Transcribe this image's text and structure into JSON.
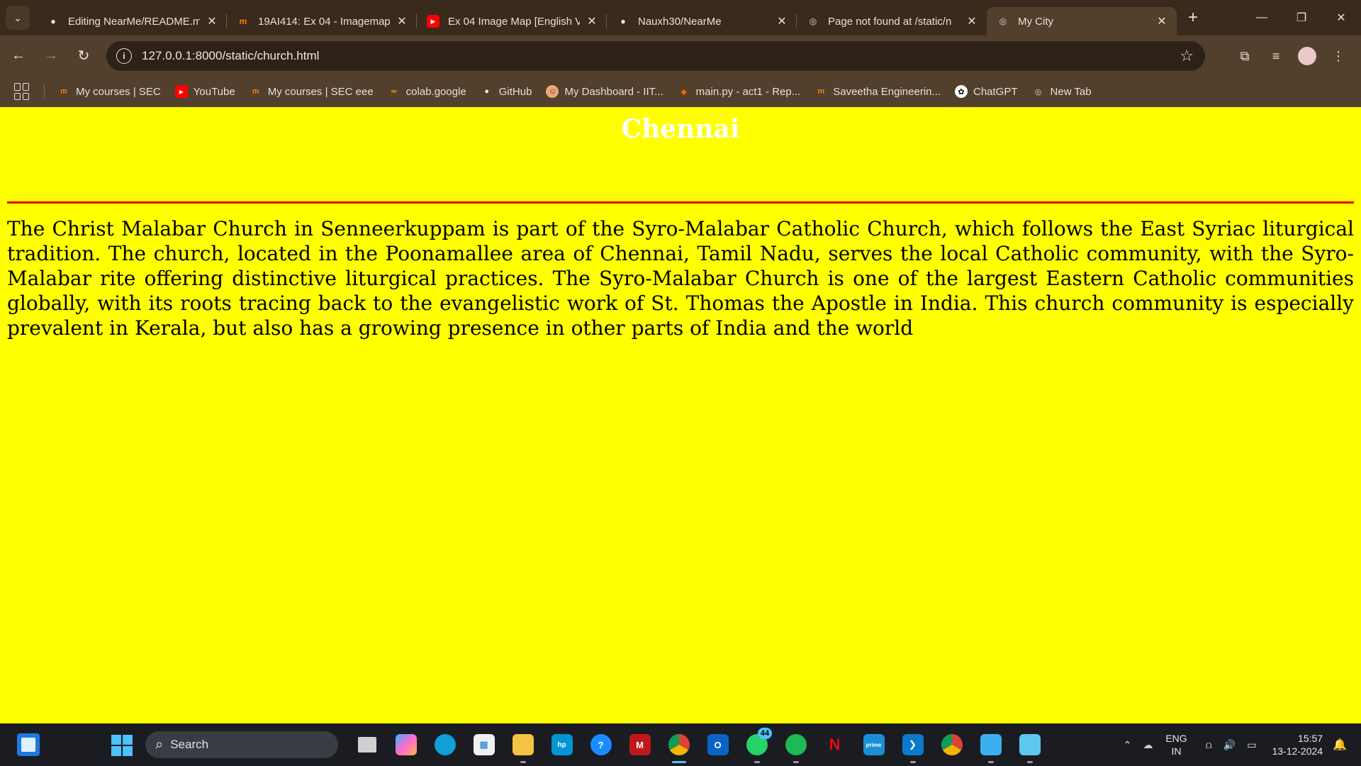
{
  "browser": {
    "tabs": [
      {
        "title": "Editing NearMe/README.md",
        "favicon": "github-icon",
        "active": false
      },
      {
        "title": "19AI414: Ex 04 - Imagemap",
        "favicon": "moodle-icon",
        "active": false
      },
      {
        "title": "Ex 04 Image Map [English V",
        "favicon": "youtube-icon",
        "active": false
      },
      {
        "title": "Nauxh30/NearMe",
        "favicon": "github-icon",
        "active": false
      },
      {
        "title": "Page not found at /static/n",
        "favicon": "globe-icon",
        "active": false
      },
      {
        "title": "My City",
        "favicon": "globe-icon",
        "active": true
      }
    ],
    "address": "127.0.0.1:8000/static/church.html",
    "bookmarks": [
      {
        "label": "My courses | SEC",
        "icon": "moodle-icon"
      },
      {
        "label": "YouTube",
        "icon": "youtube-icon"
      },
      {
        "label": "My courses | SEC eee",
        "icon": "moodle-icon"
      },
      {
        "label": "colab.google",
        "icon": "colab-icon"
      },
      {
        "label": "GitHub",
        "icon": "github-icon"
      },
      {
        "label": "My Dashboard - IIT...",
        "icon": "dashboard-icon"
      },
      {
        "label": "main.py - act1 - Rep...",
        "icon": "replit-icon"
      },
      {
        "label": "Saveetha Engineerin...",
        "icon": "moodle-icon"
      },
      {
        "label": "ChatGPT",
        "icon": "chatgpt-icon"
      },
      {
        "label": "New Tab",
        "icon": "globe-icon"
      }
    ]
  },
  "page": {
    "heading": "Chennai",
    "paragraph": "The Christ Malabar Church in Senneerkuppam is part of the Syro-Malabar Catholic Church, which follows the East Syriac liturgical tradition. The church, located in the Poonamallee area of Chennai, Tamil Nadu, serves the local Catholic community, with the Syro-Malabar rite offering distinctive liturgical practices. The Syro-Malabar Church is one of the largest Eastern Catholic communities globally, with its roots tracing back to the evangelistic work of St. Thomas the Apostle in India. This church community is especially prevalent in Kerala, but also has a growing presence in other parts of India and the world",
    "background_color": "#ffff00",
    "heading_color": "#ffffff",
    "rule_color": "#e00000"
  },
  "taskbar": {
    "search_placeholder": "Search",
    "whatsapp_badge": "44",
    "language_line1": "ENG",
    "language_line2": "IN",
    "time": "15:57",
    "date": "13-12-2024"
  }
}
